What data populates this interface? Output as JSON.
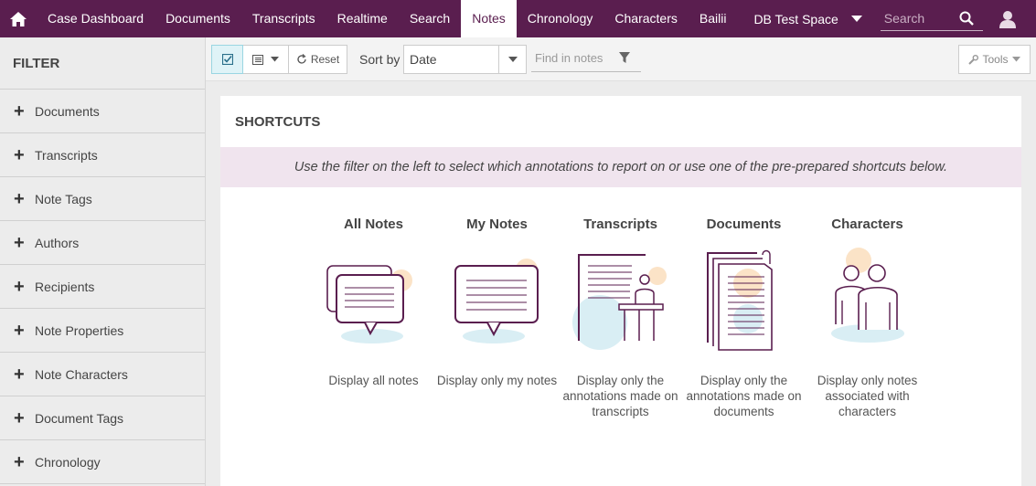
{
  "nav": {
    "items": [
      {
        "label": "Case Dashboard"
      },
      {
        "label": "Documents"
      },
      {
        "label": "Transcripts"
      },
      {
        "label": "Realtime"
      },
      {
        "label": "Search"
      },
      {
        "label": "Notes"
      },
      {
        "label": "Chronology"
      },
      {
        "label": "Characters"
      },
      {
        "label": "Bailii"
      }
    ],
    "active": "Notes",
    "space": "DB Test Space",
    "search_placeholder": "Search",
    "accent_color": "#5a1e4f",
    "icons": [
      "home-icon",
      "chevron-down-icon",
      "search-icon",
      "user-icon"
    ]
  },
  "sidebar": {
    "title": "FILTER",
    "items": [
      {
        "label": "Documents"
      },
      {
        "label": "Transcripts"
      },
      {
        "label": "Note Tags"
      },
      {
        "label": "Authors"
      },
      {
        "label": "Recipients"
      },
      {
        "label": "Note Properties"
      },
      {
        "label": "Note Characters"
      },
      {
        "label": "Document Tags"
      },
      {
        "label": "Chronology"
      }
    ]
  },
  "toolbar": {
    "reset_label": "Reset",
    "sort_label": "Sort by",
    "sort_value": "Date",
    "find_placeholder": "Find in notes",
    "tools_label": "Tools"
  },
  "main": {
    "title": "SHORTCUTS",
    "banner": "Use the filter on the left to select which annotations to report on or use one of the pre-prepared shortcuts below.",
    "shortcuts": [
      {
        "title": "All Notes",
        "desc": "Display all notes",
        "icon": "all-notes-illustration"
      },
      {
        "title": "My Notes",
        "desc": "Display only my notes",
        "icon": "my-notes-illustration"
      },
      {
        "title": "Transcripts",
        "desc": "Display only the annotations made on transcripts",
        "icon": "transcripts-illustration"
      },
      {
        "title": "Documents",
        "desc": "Display only the annotations made on documents",
        "icon": "documents-illustration"
      },
      {
        "title": "Characters",
        "desc": "Display only notes associated with characters",
        "icon": "characters-illustration"
      }
    ]
  }
}
